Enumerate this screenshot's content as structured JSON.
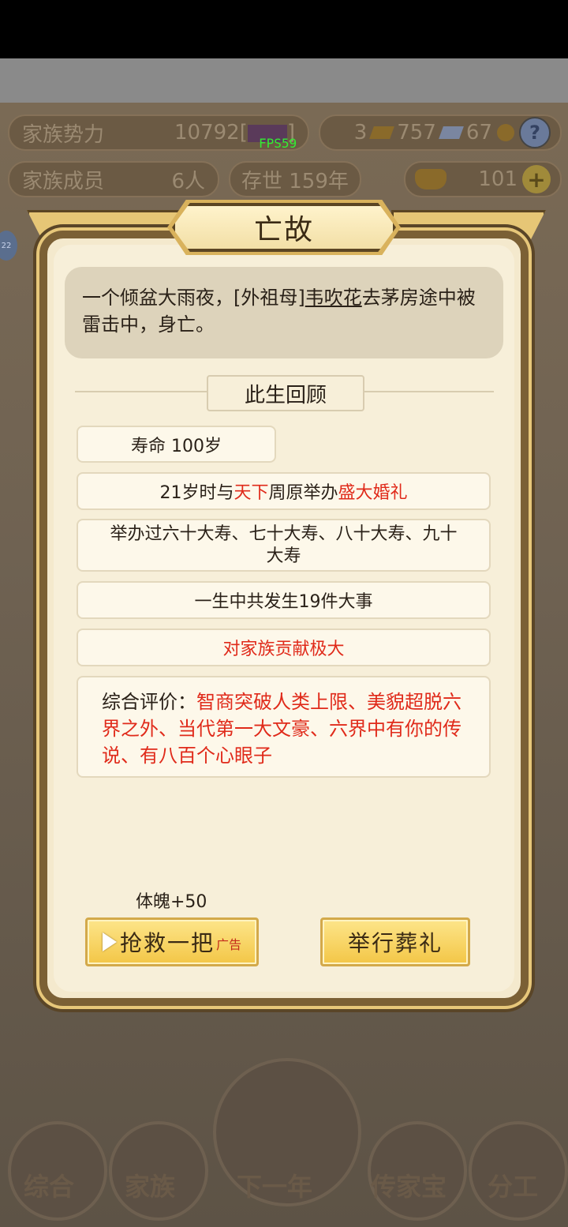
{
  "hud": {
    "clan_power_label": "家族势力",
    "clan_power_value": "10792[",
    "clan_power_suffix": "]",
    "fps": "FPS59",
    "res_a": "3",
    "res_b": "757",
    "res_c": "67",
    "help": "?",
    "members_label": "家族成员",
    "members_value": "6人",
    "years_text": "存世 159年",
    "gold_value": "101",
    "plus": "+"
  },
  "side_badge": "22",
  "bottom_nav": {
    "items": [
      "综合",
      "家族",
      "下一年",
      "传家宝",
      "分工"
    ]
  },
  "dialog": {
    "title": "亡故",
    "event": {
      "prefix": "一个倾盆大雨夜，[外祖母]",
      "name": "韦吹花",
      "suffix": "去茅房途中被雷击中，身亡。"
    },
    "review_title": "此生回顾",
    "lifespan": "寿命 100岁",
    "marriage": {
      "part1": "21岁时与",
      "place": "天下",
      "part2": "周原举办",
      "event": "盛大婚礼"
    },
    "birthdays": "举办过六十大寿、七十大寿、八十大寿、九十大寿",
    "major_events": "一生中共发生19件大事",
    "contribution": "对家族贡献极大",
    "summary_label": "综合评价：",
    "summary_text": "智商突破人类上限、美貌超脱六界之外、当代第一大文豪、六界中有你的传说、有八百个心眼子",
    "reward": "体魄+50",
    "rescue_button": "抢救一把",
    "ad_tag": "广告",
    "funeral_button": "举行葬礼"
  },
  "colors": {
    "highlight_red": "#e02a1a",
    "button_gold": "#f3c646",
    "panel_bg": "#f7efd9"
  }
}
